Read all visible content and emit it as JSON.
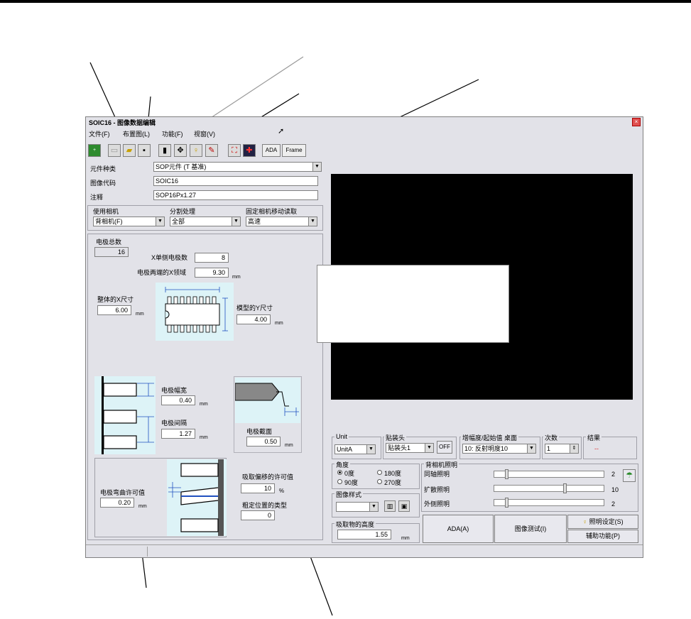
{
  "window": {
    "title": "SOIC16 - 图像数据编辑",
    "close": "×"
  },
  "menu": [
    "文件(F)",
    "布置图(L)",
    "功能(F)",
    "视窗(V)"
  ],
  "toolbar": {
    "ada": "ADA",
    "frame": "Frame"
  },
  "fields": {
    "part_type_label": "元件种类",
    "part_type_value": "SOP元件 (T 基准)",
    "image_code_label": "图像代码",
    "image_code_value": "SOIC16",
    "comment_label": "注释",
    "comment_value": "SOP16Px1.27"
  },
  "camera": {
    "use_camera_label": "使用相机",
    "use_camera_value": "背相机(F)",
    "split_label": "分割处理",
    "split_value": "全部",
    "fixed_cam_label": "固定相机移动读取",
    "fixed_cam_value": "高速"
  },
  "electrodes": {
    "total_label": "电极总数",
    "total_value": "16",
    "x_side_label": "X单侧电极数",
    "x_side_value": "8",
    "x_span_label": "电极两端的X领域",
    "x_span_value": "9.30",
    "body_x_label": "整体的X尺寸",
    "body_x_value": "6.00",
    "mold_y_label": "模型的Y尺寸",
    "mold_y_value": "4.00",
    "width_label": "电极幅宽",
    "width_value": "0.40",
    "pitch_label": "电极间隔",
    "pitch_value": "1.27",
    "section_label": "电极截面",
    "section_value": "0.50",
    "bend_label": "电极弯曲许可值",
    "bend_value": "0.20",
    "pick_offset_label": "吸取偏移的许可值",
    "pick_offset_value": "10",
    "pick_offset_unit": "%",
    "rough_pos_label": "粗定位置的类型",
    "rough_pos_value": "0",
    "unit_mm": "mm"
  },
  "bottom": {
    "unit_label": "Unit",
    "unit_value": "UnitA",
    "head_label": "贴装头",
    "head_value": "贴装头1",
    "off_btn": "OFF",
    "amp_label": "增幅度/起始值 桌面",
    "amp_value": "10: 反射明度10",
    "count_label": "次数",
    "count_value": "1",
    "result_label": "结果",
    "result_value": "--",
    "angle_label": "角度",
    "angle_0": "0度",
    "angle_90": "90度",
    "angle_180": "180度",
    "angle_270": "270度",
    "image_mode_label": "图像样式",
    "height_label": "吸取物的高度",
    "height_value": "1.55",
    "back_light_label": "背相机照明",
    "coaxial_label": "同轴照明",
    "coaxial_value": "2",
    "diffuse_label": "扩散照明",
    "diffuse_value": "10",
    "outer_label": "外侧照明",
    "outer_value": "2",
    "ada_btn": "ADA(A)",
    "test_btn": "图像测试(I)",
    "light_btn": "照明设定(S)",
    "aux_btn": "辅助功能(P)"
  },
  "settings": {
    "coaxial_level": 0.1,
    "diffuse_level": 0.65,
    "outer_level": 0.1
  }
}
